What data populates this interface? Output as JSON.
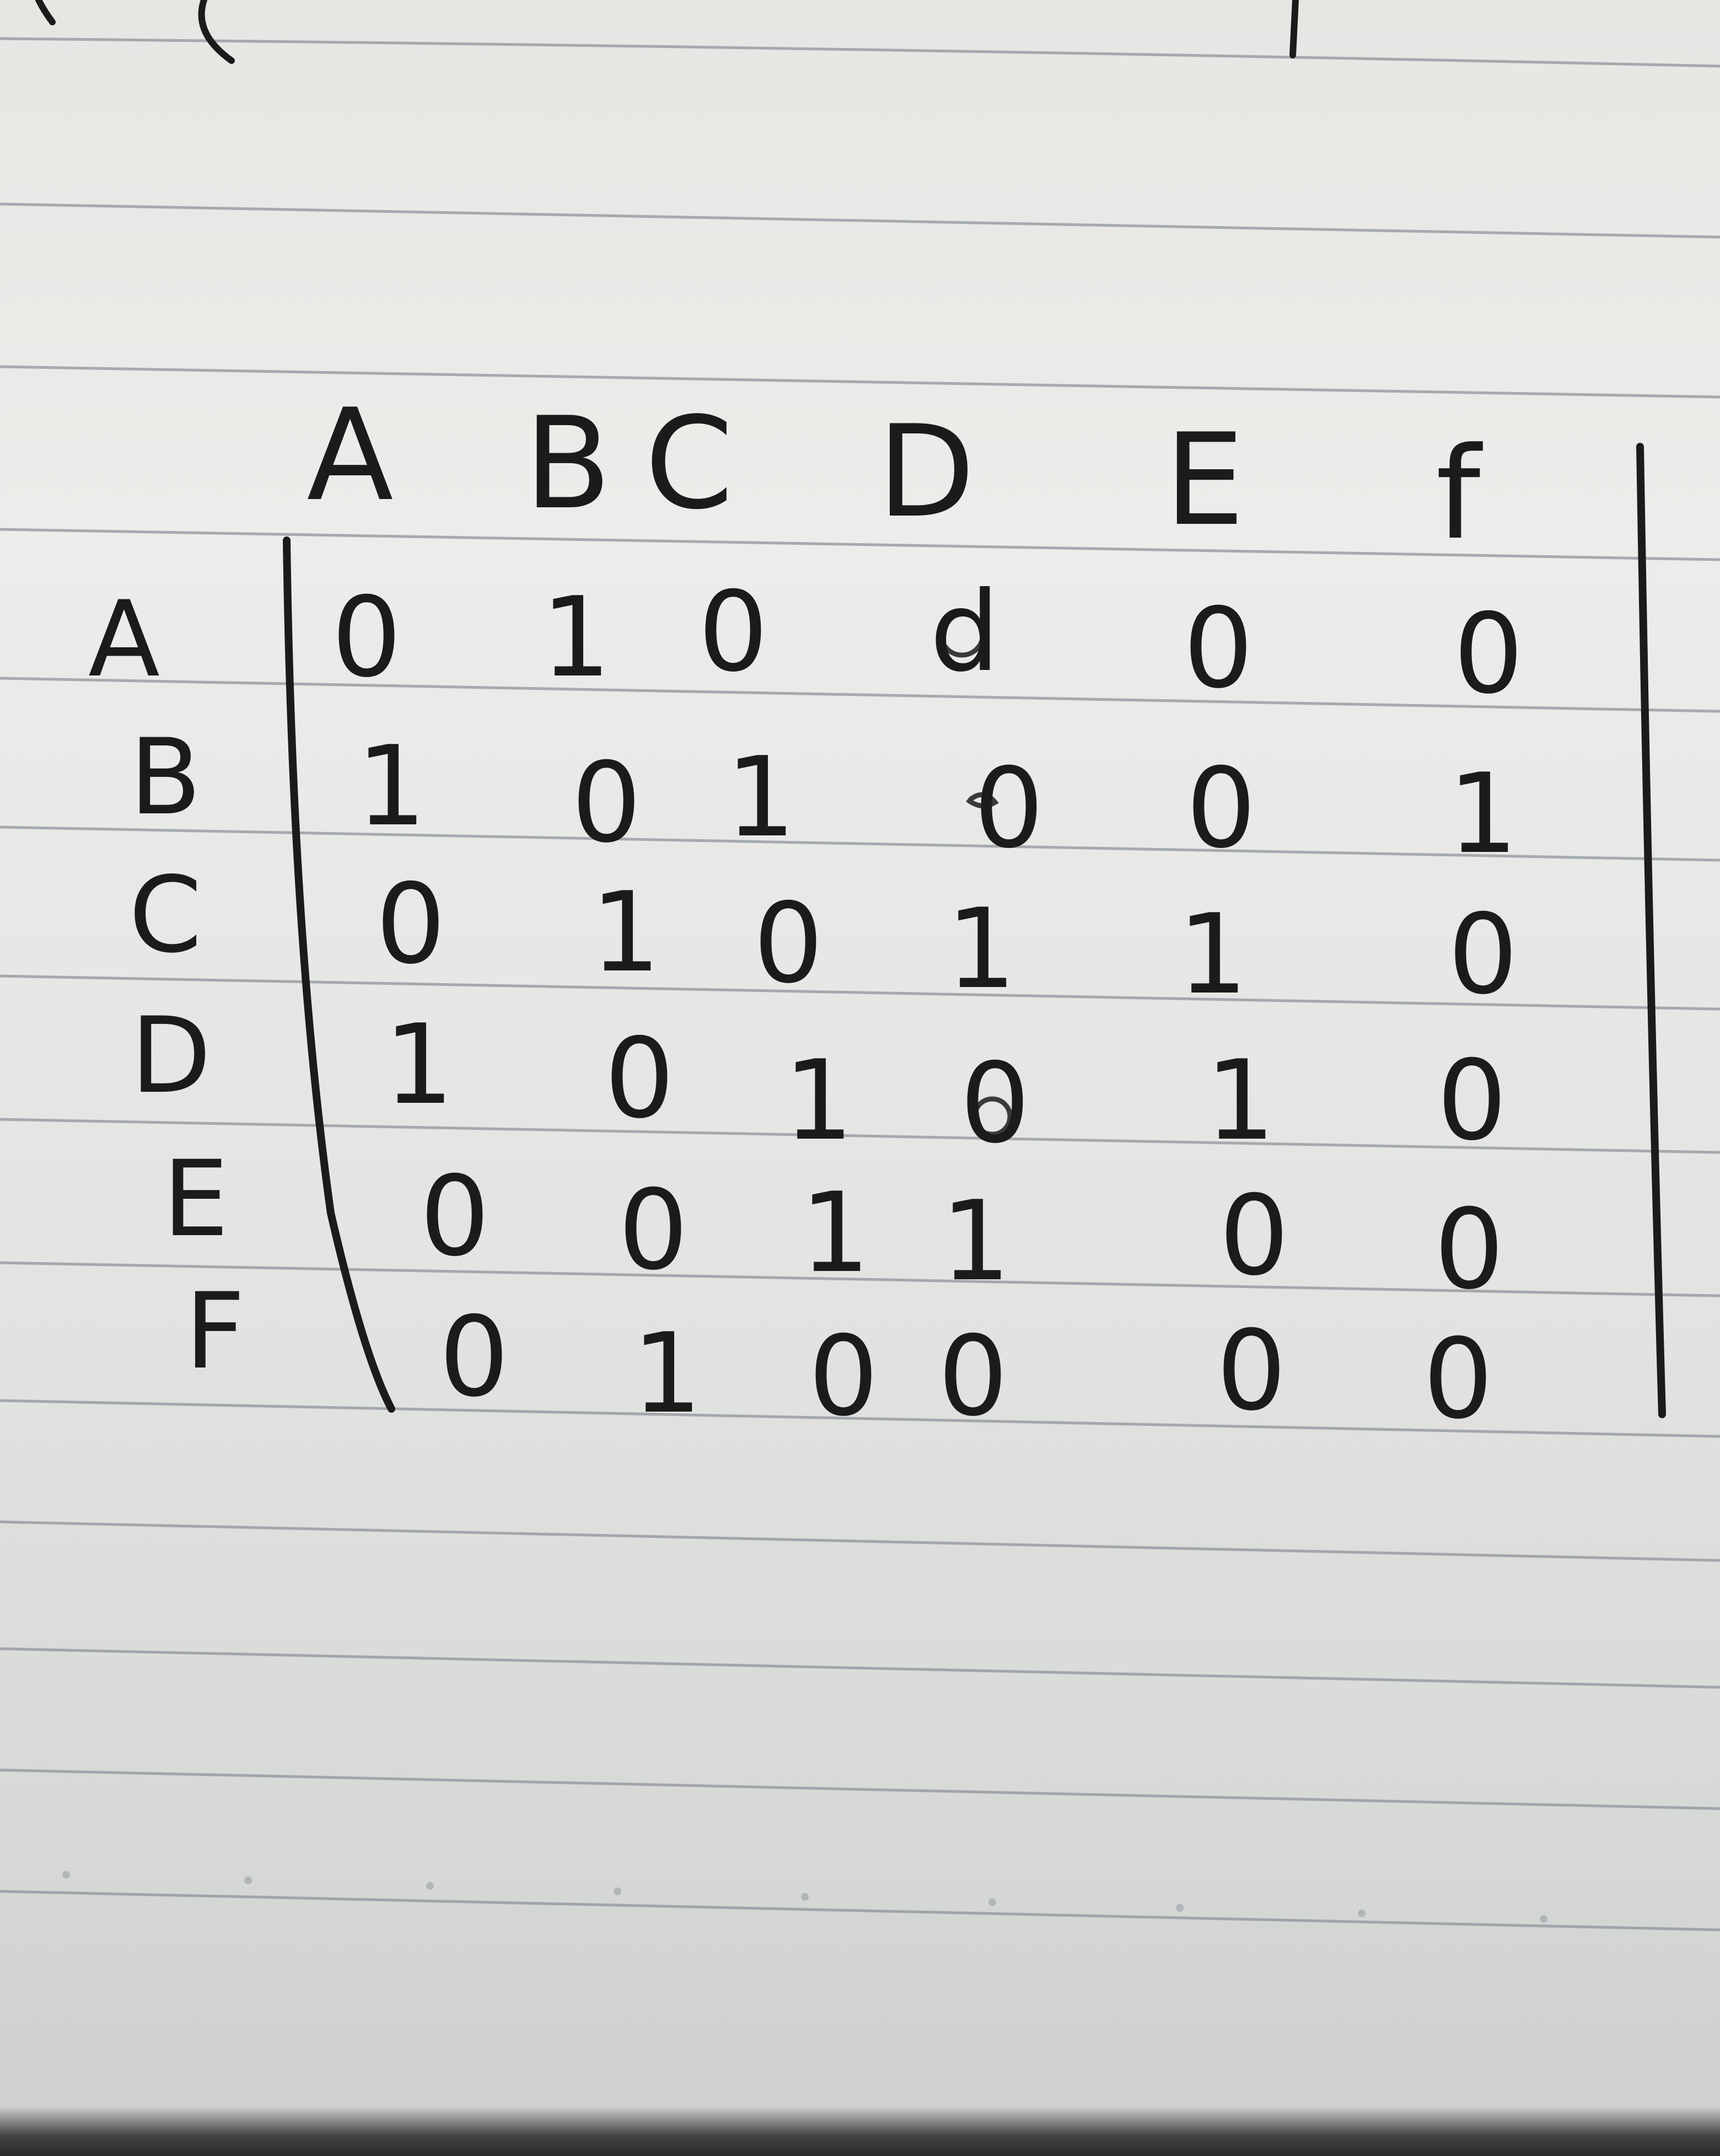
{
  "matrix": {
    "column_labels": [
      "A",
      "B",
      "C",
      "D",
      "E",
      "f"
    ],
    "row_labels": [
      "A",
      "B",
      "C",
      "D",
      "E",
      "F"
    ],
    "rows": [
      [
        "0",
        "1",
        "0",
        "d",
        "0",
        "0"
      ],
      [
        "1",
        "0",
        "1",
        "0",
        "0",
        "1"
      ],
      [
        "0",
        "1",
        "0",
        "1",
        "1",
        "0"
      ],
      [
        "1",
        "0",
        "1",
        "0",
        "1",
        "0"
      ],
      [
        "0",
        "0",
        "1",
        "1",
        "0",
        "0"
      ],
      [
        "0",
        "1",
        "0",
        "0",
        "0",
        "0"
      ]
    ]
  },
  "colors": {
    "paper": "#e8e8e5",
    "rule_line": "#8d949c",
    "ink": "#1b1b1b"
  }
}
